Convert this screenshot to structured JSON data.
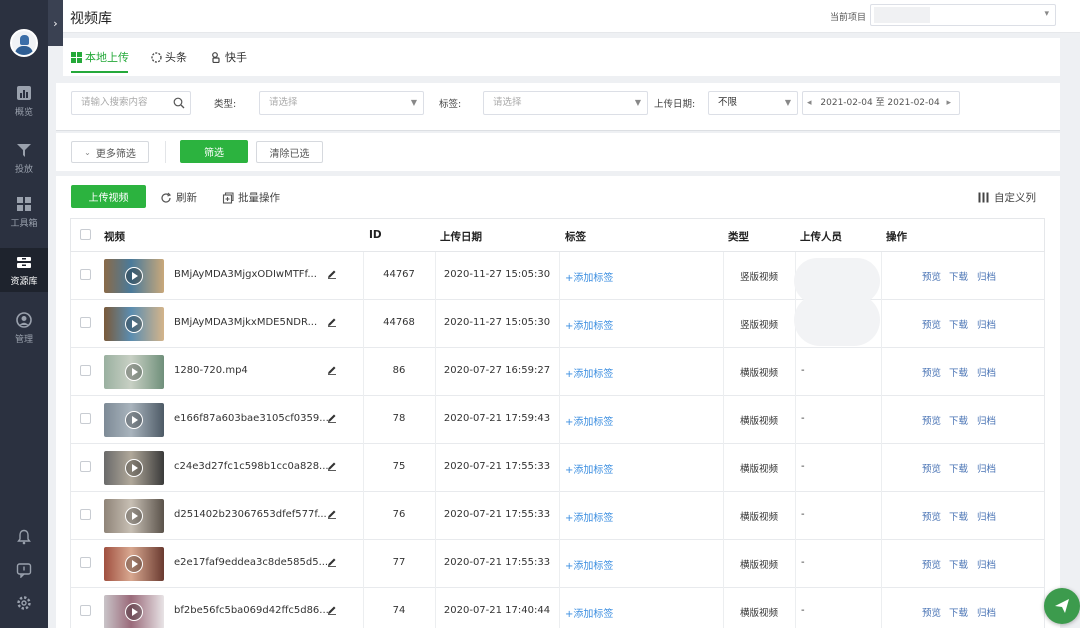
{
  "header": {
    "title": "视频库",
    "project_label": "当前项目"
  },
  "sidebar": {
    "items": [
      {
        "label": "概览",
        "icon": "bar-chart-icon"
      },
      {
        "label": "投放",
        "icon": "send-icon"
      },
      {
        "label": "工具箱",
        "icon": "grid-icon"
      },
      {
        "label": "资源库",
        "icon": "stack-icon",
        "active": true
      },
      {
        "label": "管理",
        "icon": "user-circle-icon"
      }
    ],
    "bottom_icons": [
      "bell-icon",
      "message-icon",
      "gear-icon"
    ]
  },
  "tabs": [
    {
      "label": "本地上传",
      "icon": "grid-icon",
      "active": true
    },
    {
      "label": "头条",
      "icon": "toutiao-icon"
    },
    {
      "label": "快手",
      "icon": "kuaishou-icon"
    }
  ],
  "filters": {
    "search_placeholder": "请输入搜索内容",
    "type_label": "类型:",
    "type_placeholder": "请选择",
    "tag_label": "标签:",
    "tag_placeholder": "请选择",
    "date_label": "上传日期:",
    "date_option": "不限",
    "date_range": "2021-02-04 至 2021-02-04",
    "more_label": "更多筛选",
    "filter_label": "筛选",
    "clear_label": "清除已选"
  },
  "toolbar": {
    "upload_label": "上传视频",
    "refresh_label": "刷新",
    "batch_label": "批量操作",
    "custom_columns_label": "自定义列"
  },
  "table": {
    "columns": [
      "视频",
      "ID",
      "上传日期",
      "标签",
      "类型",
      "上传人员",
      "操作"
    ],
    "add_tag_label": "+添加标签",
    "actions": [
      "预览",
      "下载",
      "归档"
    ],
    "rows": [
      {
        "name": "BMjAyMDA3MjgxODIwMTFf...",
        "id": "44767",
        "date": "2020-11-27 15:05:30",
        "type": "竖版视频",
        "uploader": ""
      },
      {
        "name": "BMjAyMDA3MjkxMDE5NDR...",
        "id": "44768",
        "date": "2020-11-27 15:05:30",
        "type": "竖版视频",
        "uploader": ""
      },
      {
        "name": "1280-720.mp4",
        "id": "86",
        "date": "2020-07-27 16:59:27",
        "type": "横版视频",
        "uploader": "-"
      },
      {
        "name": "e166f87a603bae3105cf0359...",
        "id": "78",
        "date": "2020-07-21 17:59:43",
        "type": "横版视频",
        "uploader": "-"
      },
      {
        "name": "c24e3d27fc1c598b1cc0a828...",
        "id": "75",
        "date": "2020-07-21 17:55:33",
        "type": "横版视频",
        "uploader": "-"
      },
      {
        "name": "d251402b23067653dfef577f...",
        "id": "76",
        "date": "2020-07-21 17:55:33",
        "type": "横版视频",
        "uploader": "-"
      },
      {
        "name": "e2e17faf9eddea3c8de585d5...",
        "id": "77",
        "date": "2020-07-21 17:55:33",
        "type": "横版视频",
        "uploader": "-"
      },
      {
        "name": "bf2be56fc5ba069d42ffc5d86...",
        "id": "74",
        "date": "2020-07-21 17:40:44",
        "type": "横版视频",
        "uploader": "-"
      }
    ]
  },
  "colors": {
    "brand_green": "#2cb33f",
    "link_blue": "#3b8ee0",
    "sidebar_bg": "#2b3140"
  }
}
